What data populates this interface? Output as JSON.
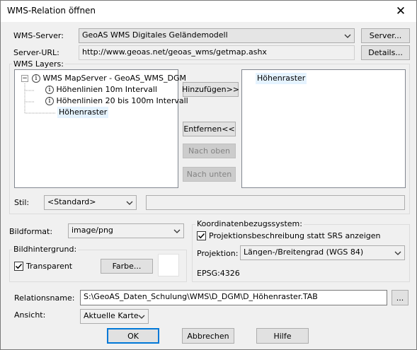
{
  "window": {
    "title": "WMS-Relation öffnen",
    "close_glyph": "✕"
  },
  "server": {
    "label": "WMS-Server:",
    "selected": "GeoAS WMS Digitales Geländemodell",
    "server_button": "Server...",
    "url_label": "Server-URL:",
    "url_value": "http://www.geoas.net/geoas_wms/getmap.ashx",
    "details_button": "Details..."
  },
  "layers": {
    "group_title": "WMS Layers:",
    "tree": {
      "expander": "−",
      "root_label": "WMS MapServer - GeoAS_WMS_DGM",
      "children": [
        {
          "label": "Höhenlinien 10m Intervall",
          "icon": "info-icon"
        },
        {
          "label": "Höhenlinien 20 bis 100m Intervall",
          "icon": "info-icon"
        },
        {
          "label": "Höhenraster",
          "icon": "none"
        }
      ]
    },
    "add_button": "Hinzufügen>>",
    "remove_button": "Entfernen<<",
    "up_button": "Nach oben",
    "down_button": "Nach unten",
    "selected_layers": [
      "Höhenraster"
    ],
    "style_label": "Stil:",
    "style_value": "<Standard>",
    "style_text": ""
  },
  "image": {
    "format_label": "Bildformat:",
    "format_value": "image/png",
    "background_title": "Bildhintergrund:",
    "transparent_label": "Transparent",
    "transparent_checked": true,
    "color_button": "Farbe...",
    "swatch_color": "#ffffff"
  },
  "crs": {
    "group_title": "Koordinatenbezugssystem:",
    "projdesc_label": "Projektionsbeschreibung statt SRS anzeigen",
    "projdesc_checked": true,
    "projection_label": "Projektion:",
    "projection_value": "Längen-/Breitengrad (WGS 84)",
    "epsg": "EPSG:4326"
  },
  "relation": {
    "name_label": "Relationsname:",
    "name_value": "S:\\GeoAS_Daten_Schulung\\WMS\\D_DGM\\D_Höhenraster.TAB",
    "browse_button": "...",
    "view_label": "Ansicht:",
    "view_value": "Aktuelle Karte"
  },
  "footer": {
    "ok": "OK",
    "cancel": "Abbrechen",
    "help": "Hilfe"
  },
  "colors": {
    "accent": "#0078d7",
    "selection": "#e5f3ff"
  }
}
